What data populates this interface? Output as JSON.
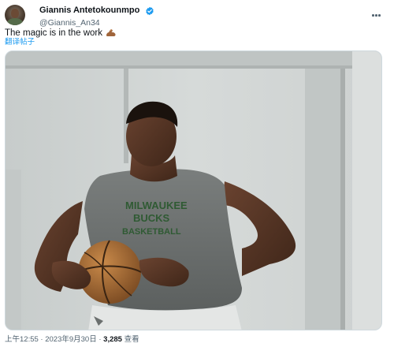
{
  "author": {
    "display_name": "Giannis Antetokounmpo",
    "handle": "@Giannis_An34",
    "verified": true,
    "avatar_icon": "profile-photo"
  },
  "tweet": {
    "text": "The magic is in the work",
    "emoji_icon": "flexed-biceps",
    "translate_label": "翻译帖子"
  },
  "media": {
    "description_icon": "photo-basketball-player",
    "jersey_lines": [
      "MILWAUKEE",
      "BUCKS",
      "BASKETBALL"
    ]
  },
  "meta": {
    "time": "上午12:55",
    "separator": "·",
    "date": "2023年9月30日",
    "views_count": "3,285",
    "views_label": "查看"
  },
  "colors": {
    "accent": "#1d9bf0",
    "text_primary": "#0f1419",
    "text_secondary": "#536471",
    "jersey": "#6d7170",
    "jersey_text": "#2f5a33"
  }
}
